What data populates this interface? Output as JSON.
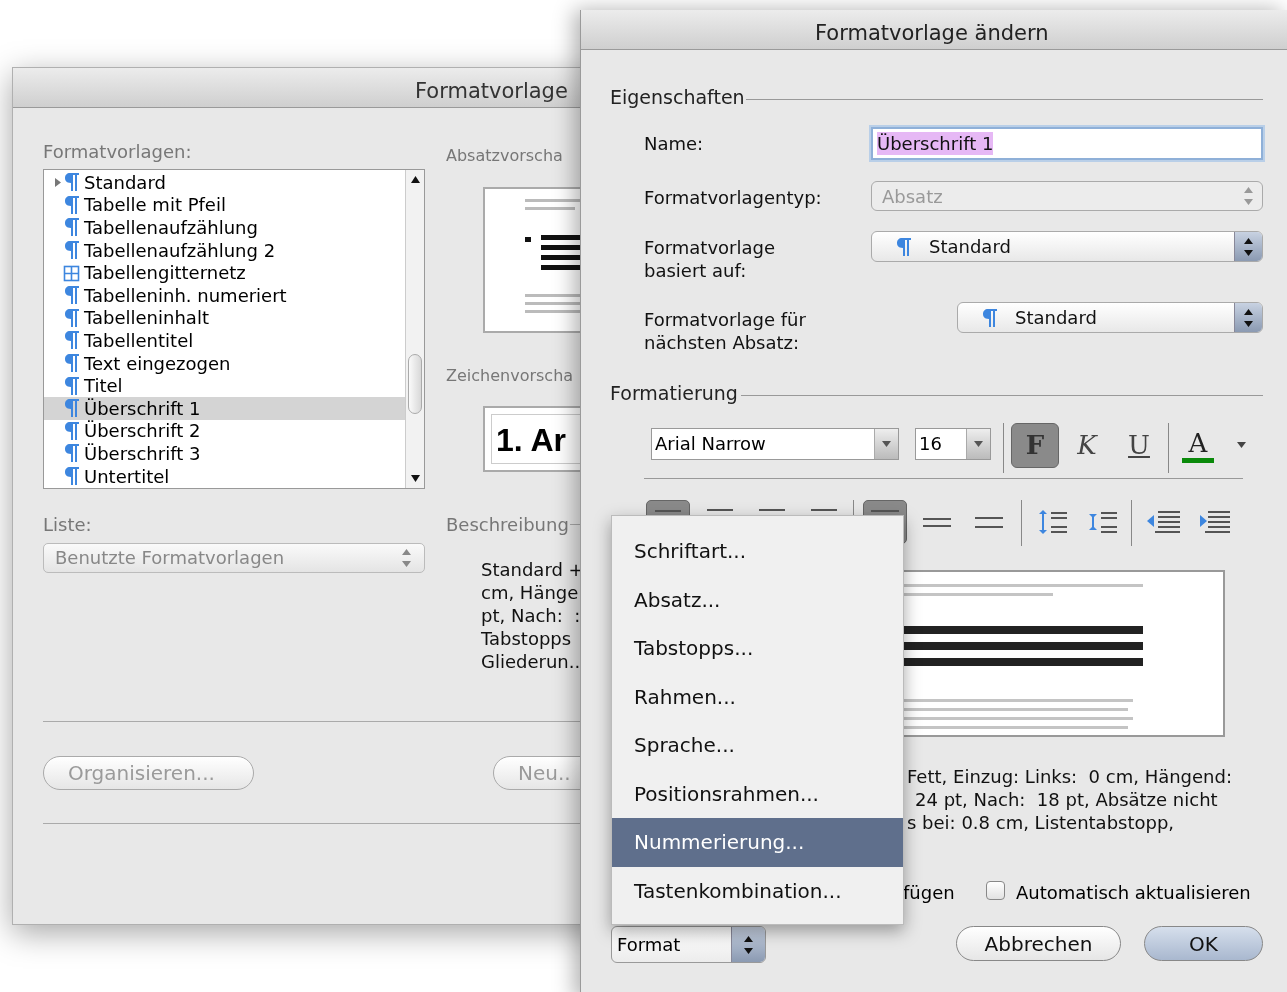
{
  "back_window": {
    "title": "Formatvorlage",
    "styles_label": "Formatvorlagen:",
    "styles": [
      {
        "name": "Standard",
        "kind": "paragraph",
        "disclosure": true,
        "selected": false
      },
      {
        "name": "Tabelle mit Pfeil",
        "kind": "paragraph",
        "disclosure": false,
        "selected": false
      },
      {
        "name": "Tabellenaufzählung",
        "kind": "paragraph",
        "disclosure": false,
        "selected": false
      },
      {
        "name": "Tabellenaufzählung 2",
        "kind": "paragraph",
        "disclosure": false,
        "selected": false
      },
      {
        "name": "Tabellengitternetz",
        "kind": "table",
        "disclosure": false,
        "selected": false
      },
      {
        "name": "Tabelleninh. numeriert",
        "kind": "paragraph",
        "disclosure": false,
        "selected": false
      },
      {
        "name": "Tabelleninhalt",
        "kind": "paragraph",
        "disclosure": false,
        "selected": false
      },
      {
        "name": "Tabellentitel",
        "kind": "paragraph",
        "disclosure": false,
        "selected": false
      },
      {
        "name": "Text eingezogen",
        "kind": "paragraph",
        "disclosure": false,
        "selected": false
      },
      {
        "name": "Titel",
        "kind": "paragraph",
        "disclosure": false,
        "selected": false
      },
      {
        "name": "Überschrift 1",
        "kind": "paragraph",
        "disclosure": false,
        "selected": true
      },
      {
        "name": "Überschrift 2",
        "kind": "paragraph",
        "disclosure": false,
        "selected": false
      },
      {
        "name": "Überschrift 3",
        "kind": "paragraph",
        "disclosure": false,
        "selected": false
      },
      {
        "name": "Untertitel",
        "kind": "paragraph",
        "disclosure": false,
        "selected": false
      }
    ],
    "paragraph_preview_label": "Absatzvorscha",
    "character_preview_label": "Zeichenvorscha",
    "character_preview_text": "1. Ar",
    "list_label": "Liste:",
    "list_popup": {
      "value": "Benutzte Formatvorlagen",
      "disabled": true
    },
    "description_label": "Beschreibung",
    "description_lines": [
      "Standard +",
      "cm, Hänge",
      "pt, Nach:  :",
      "Tabstopps",
      "Gliederun.."
    ],
    "buttons": [
      {
        "label": "Organisieren...",
        "disabled": true
      },
      {
        "label": "Neu..",
        "disabled": true
      }
    ]
  },
  "front_window": {
    "title": "Formatvorlage ändern",
    "properties_label": "Eigenschaften",
    "fields": [
      {
        "label": "Name:",
        "kind": "text",
        "value": "Überschrift 1",
        "disabled": false
      },
      {
        "label": "Formatvorlagentyp:",
        "kind": "popup",
        "value": "Absatz",
        "disabled": true
      },
      {
        "label": "Formatvorlage\nbasiert auf:",
        "kind": "style_popup",
        "value": "Standard",
        "disabled": false
      },
      {
        "label": "Formatvorlage für\nnächsten Absatz:",
        "kind": "style_popup",
        "value": "Standard",
        "disabled": false
      }
    ],
    "formatting_label": "Formatierung",
    "font": "Arial Narrow",
    "size": "16",
    "style_buttons": [
      {
        "label": "F",
        "kind": "bold",
        "on": true
      },
      {
        "label": "K",
        "kind": "italic",
        "on": false
      },
      {
        "label": "U",
        "kind": "underline",
        "on": false
      }
    ],
    "font_color_label": "A",
    "paragraph_buttons": [
      {
        "kind": "align-left",
        "on": true
      },
      {
        "kind": "align-center",
        "on": false
      },
      {
        "kind": "align-right",
        "on": false
      },
      {
        "kind": "justify",
        "on": false
      },
      {
        "kind": "line-single",
        "on": true
      },
      {
        "kind": "line-half",
        "on": false
      },
      {
        "kind": "line-double",
        "on": false
      },
      {
        "kind": "space-more",
        "on": false
      },
      {
        "kind": "space-less",
        "on": false
      },
      {
        "kind": "outdent",
        "on": false
      },
      {
        "kind": "indent",
        "on": false
      }
    ],
    "description_lines": [
      "Fett, Einzug: Links:  0 cm, Hängend:",
      "24 pt, Nach:  18 pt, Absätze nicht",
      "s bei: 0.8 cm, Listentabstopp,"
    ],
    "add_to_template_partial": "fügen",
    "auto_update": {
      "label": "Automatisch aktualisieren",
      "checked": false
    },
    "format_popup": "Format",
    "buttons": [
      {
        "label": "Abbrechen",
        "default": false
      },
      {
        "label": "OK",
        "default": true
      }
    ],
    "format_menu": [
      {
        "label": "Schriftart...",
        "selected": false
      },
      {
        "label": "Absatz...",
        "selected": false
      },
      {
        "label": "Tabstopps...",
        "selected": false
      },
      {
        "label": "Rahmen...",
        "selected": false
      },
      {
        "label": "Sprache...",
        "selected": false
      },
      {
        "label": "Positionsrahmen...",
        "selected": false
      },
      {
        "label": "Nummerierung...",
        "selected": true
      },
      {
        "label": "Tastenkombination...",
        "selected": false
      }
    ]
  }
}
